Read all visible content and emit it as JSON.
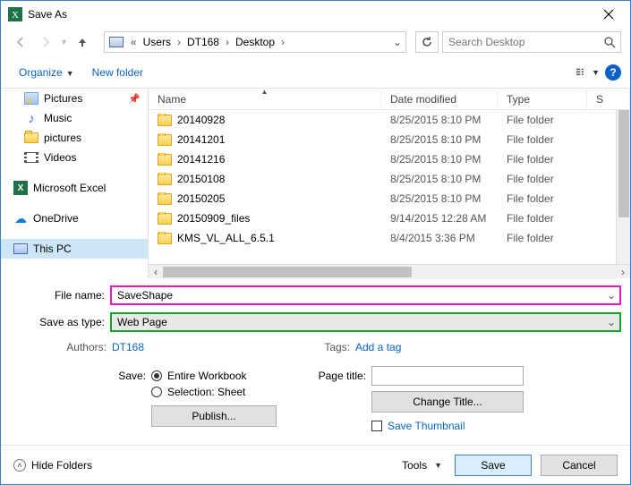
{
  "title": "Save As",
  "breadcrumb": [
    "Users",
    "DT168",
    "Desktop"
  ],
  "search": {
    "placeholder": "Search Desktop"
  },
  "toolbar": {
    "organize": "Organize",
    "newfolder": "New folder"
  },
  "sidebar": {
    "items": [
      {
        "label": "Pictures",
        "pinned": true
      },
      {
        "label": "Music"
      },
      {
        "label": "pictures"
      },
      {
        "label": "Videos"
      },
      {
        "label": "Microsoft Excel"
      },
      {
        "label": "OneDrive"
      },
      {
        "label": "This PC"
      }
    ]
  },
  "columns": {
    "name": "Name",
    "date": "Date modified",
    "type": "Type",
    "size": "S"
  },
  "files": [
    {
      "name": "20140928",
      "date": "8/25/2015 8:10 PM",
      "type": "File folder"
    },
    {
      "name": "20141201",
      "date": "8/25/2015 8:10 PM",
      "type": "File folder"
    },
    {
      "name": "20141216",
      "date": "8/25/2015 8:10 PM",
      "type": "File folder"
    },
    {
      "name": "20150108",
      "date": "8/25/2015 8:10 PM",
      "type": "File folder"
    },
    {
      "name": "20150205",
      "date": "8/25/2015 8:10 PM",
      "type": "File folder"
    },
    {
      "name": "20150909_files",
      "date": "9/14/2015 12:28 AM",
      "type": "File folder"
    },
    {
      "name": "KMS_VL_ALL_6.5.1",
      "date": "8/4/2015 3:36 PM",
      "type": "File folder"
    }
  ],
  "form": {
    "filename_label": "File name:",
    "filename_value": "SaveShape",
    "type_label": "Save as type:",
    "type_value": "Web Page",
    "authors_label": "Authors:",
    "authors_value": "DT168",
    "tags_label": "Tags:",
    "tags_value": "Add a tag",
    "save_label": "Save:",
    "radio_workbook": "Entire Workbook",
    "radio_selection": "Selection: Sheet",
    "publish": "Publish...",
    "pagetitle_label": "Page title:",
    "change_title": "Change Title...",
    "save_thumb": "Save Thumbnail"
  },
  "footer": {
    "hide_folders": "Hide Folders",
    "tools": "Tools",
    "save": "Save",
    "cancel": "Cancel"
  }
}
